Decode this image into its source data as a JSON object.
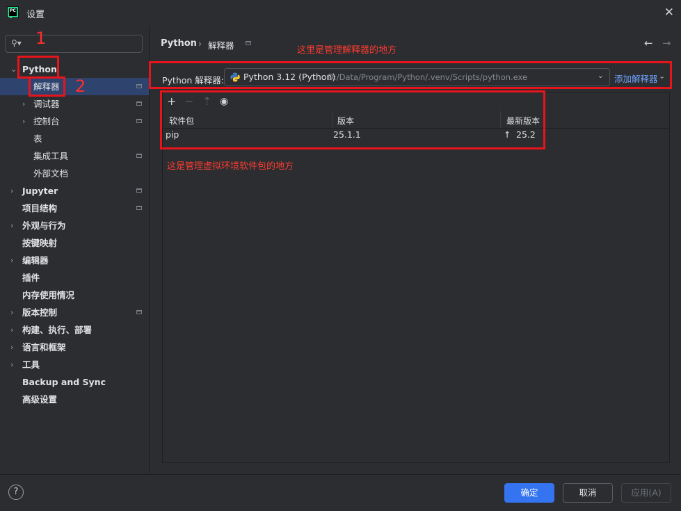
{
  "window": {
    "title": "设置"
  },
  "sidebar": {
    "search_placeholder": "",
    "items": [
      {
        "label": "Python",
        "expanded": true
      },
      {
        "label": "解释器",
        "selected": true
      },
      {
        "label": "调试器"
      },
      {
        "label": "控制台"
      },
      {
        "label": "表"
      },
      {
        "label": "集成工具"
      },
      {
        "label": "外部文档"
      },
      {
        "label": "Jupyter"
      },
      {
        "label": "项目结构"
      },
      {
        "label": "外观与行为"
      },
      {
        "label": "按键映射"
      },
      {
        "label": "编辑器"
      },
      {
        "label": "插件"
      },
      {
        "label": "内存使用情况"
      },
      {
        "label": "版本控制"
      },
      {
        "label": "构建、执行、部署"
      },
      {
        "label": "语言和框架"
      },
      {
        "label": "工具"
      },
      {
        "label": "Backup and Sync"
      },
      {
        "label": "高级设置"
      }
    ]
  },
  "breadcrumb": {
    "parent": "Python",
    "current": "解释器"
  },
  "interpreter": {
    "label": "Python 解释器:",
    "name": "Python 3.12 (Python)",
    "path": "D:/Data/Program/Python/.venv/Scripts/python.exe",
    "add_label": "添加解释器"
  },
  "packages": {
    "columns": [
      "软件包",
      "版本",
      "最新版本"
    ],
    "rows": [
      {
        "package": "pip",
        "version": "25.1.1",
        "latest": "25.2"
      }
    ]
  },
  "annotations": {
    "note_interpreter": "这里是管理解释器的地方",
    "note_packages": "这是管理虚拟环境软件包的地方",
    "num_1": "1",
    "num_2": "2"
  },
  "footer": {
    "help": "?",
    "ok": "确定",
    "cancel": "取消",
    "apply": "应用(A)"
  },
  "colors": {
    "accent": "#3574f0",
    "selection": "#2e436e",
    "annotation": "#e8141c",
    "link": "#6ea0f7"
  }
}
